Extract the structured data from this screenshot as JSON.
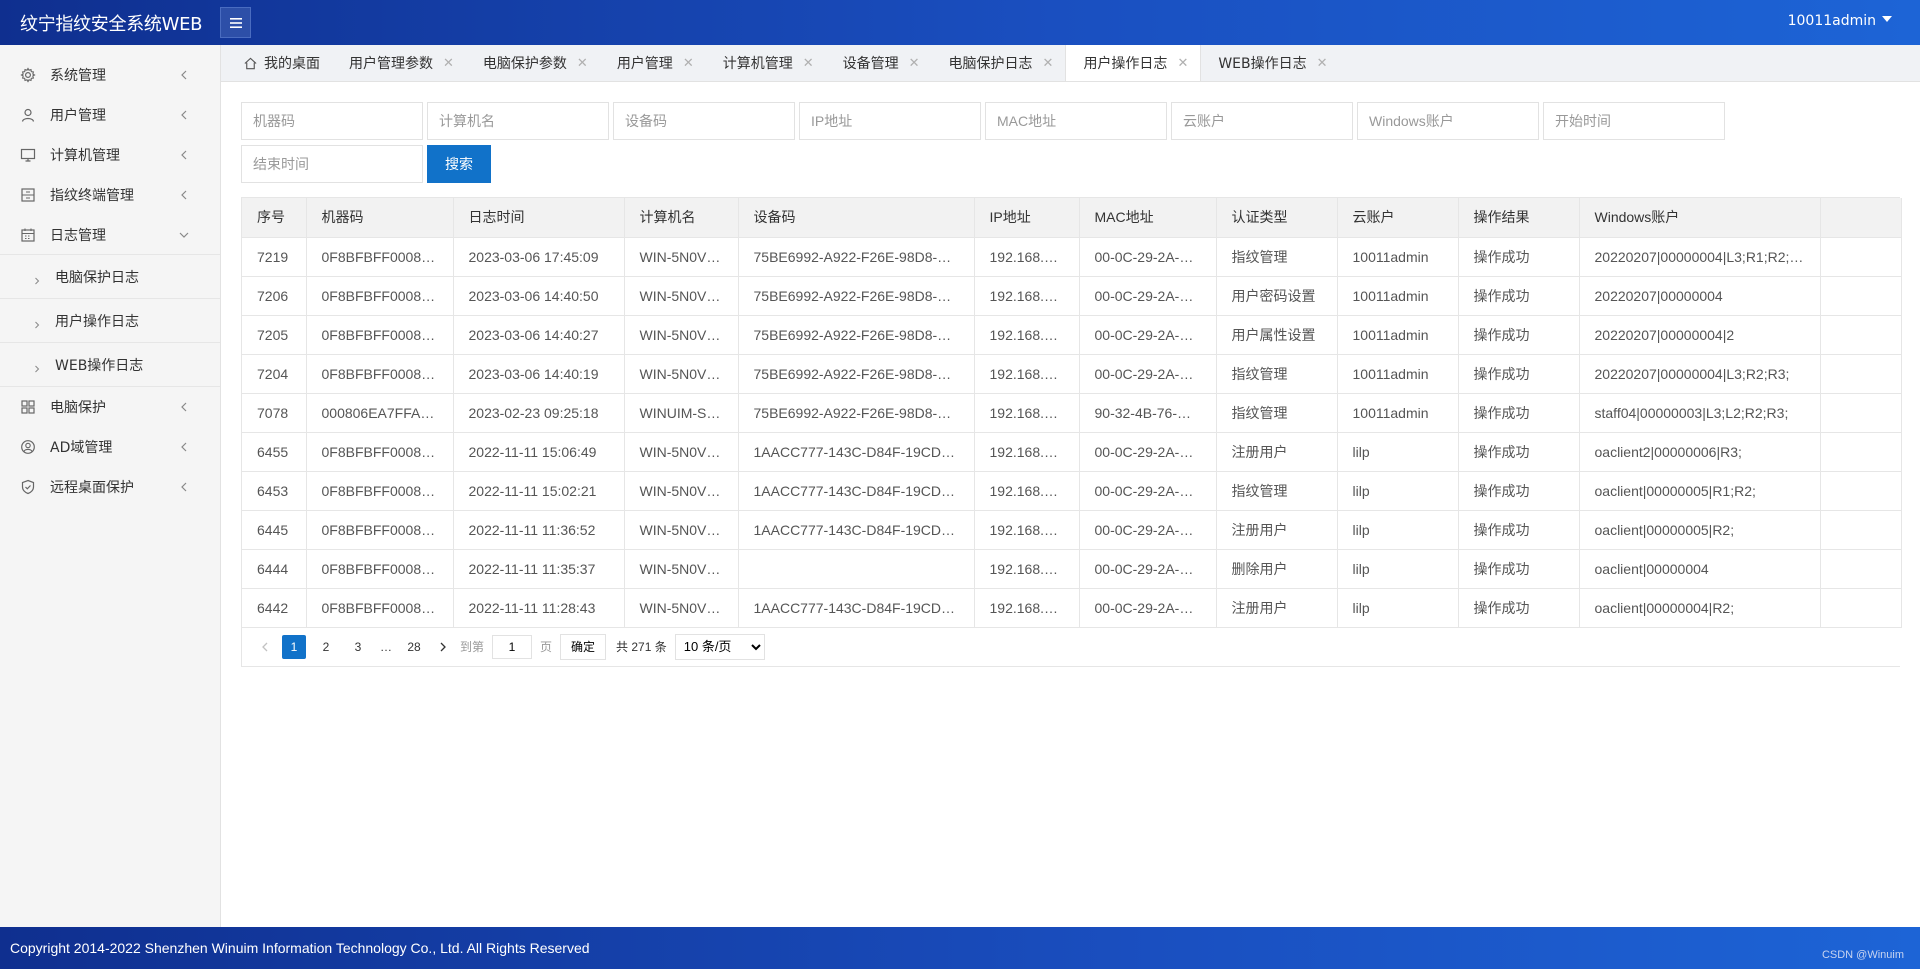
{
  "app": {
    "title": "纹宁指纹安全系统WEB",
    "user": "10011admin"
  },
  "sidebar": {
    "items": [
      {
        "label": "系统管理",
        "icon": "gear-icon"
      },
      {
        "label": "用户管理",
        "icon": "user-icon"
      },
      {
        "label": "计算机管理",
        "icon": "monitor-icon"
      },
      {
        "label": "指纹终端管理",
        "icon": "terminal-icon"
      },
      {
        "label": "日志管理",
        "icon": "calendar-icon"
      }
    ],
    "log_sub": [
      "电脑保护日志",
      "用户操作日志",
      "WEB操作日志"
    ],
    "items_after": [
      {
        "label": "电脑保护",
        "icon": "grid-icon"
      },
      {
        "label": "AD域管理",
        "icon": "ad-user-icon"
      },
      {
        "label": "远程桌面保护",
        "icon": "shield-icon"
      }
    ]
  },
  "tabs": [
    {
      "label": "我的桌面",
      "closable": false
    },
    {
      "label": "用户管理参数",
      "closable": true
    },
    {
      "label": "电脑保护参数",
      "closable": true
    },
    {
      "label": "用户管理",
      "closable": true
    },
    {
      "label": "计算机管理",
      "closable": true
    },
    {
      "label": "设备管理",
      "closable": true
    },
    {
      "label": "电脑保护日志",
      "closable": true
    },
    {
      "label": "用户操作日志",
      "closable": true,
      "active": true
    },
    {
      "label": "WEB操作日志",
      "closable": true
    }
  ],
  "filters": {
    "machine_code": "机器码",
    "computer_name": "计算机名",
    "device_code": "设备码",
    "ip": "IP地址",
    "mac": "MAC地址",
    "cloud_account": "云账户",
    "windows_account": "Windows账户",
    "start_time": "开始时间",
    "end_time": "结束时间",
    "search_label": "搜索"
  },
  "table": {
    "headers": [
      "序号",
      "机器码",
      "日志时间",
      "计算机名",
      "设备码",
      "IP地址",
      "MAC地址",
      "认证类型",
      "云账户",
      "操作结果",
      "Windows账户"
    ],
    "rows": [
      [
        "7219",
        "0F8BFBFF0008…",
        "2023-03-06 17:45:09",
        "WIN-5N0V…",
        "75BE6992-A922-F26E-98D8-…",
        "192.168.…",
        "00-0C-29-2A-…",
        "指纹管理",
        "10011admin",
        "操作成功",
        "20220207|00000004|L3;R1;R2;…"
      ],
      [
        "7206",
        "0F8BFBFF0008…",
        "2023-03-06 14:40:50",
        "WIN-5N0V…",
        "75BE6992-A922-F26E-98D8-…",
        "192.168.…",
        "00-0C-29-2A-…",
        "用户密码设置",
        "10011admin",
        "操作成功",
        "20220207|00000004"
      ],
      [
        "7205",
        "0F8BFBFF0008…",
        "2023-03-06 14:40:27",
        "WIN-5N0V…",
        "75BE6992-A922-F26E-98D8-…",
        "192.168.…",
        "00-0C-29-2A-…",
        "用户属性设置",
        "10011admin",
        "操作成功",
        "20220207|00000004|2"
      ],
      [
        "7204",
        "0F8BFBFF0008…",
        "2023-03-06 14:40:19",
        "WIN-5N0V…",
        "75BE6992-A922-F26E-98D8-…",
        "192.168.…",
        "00-0C-29-2A-…",
        "指纹管理",
        "10011admin",
        "操作成功",
        "20220207|00000004|L3;R2;R3;"
      ],
      [
        "7078",
        "000806EA7FFA…",
        "2023-02-23 09:25:18",
        "WINUIM-S…",
        "75BE6992-A922-F26E-98D8-…",
        "192.168.…",
        "90-32-4B-76-…",
        "指纹管理",
        "10011admin",
        "操作成功",
        "staff04|00000003|L3;L2;R2;R3;"
      ],
      [
        "6455",
        "0F8BFBFF0008…",
        "2022-11-11 15:06:49",
        "WIN-5N0V…",
        "1AACC777-143C-D84F-19CD…",
        "192.168.…",
        "00-0C-29-2A-…",
        "注册用户",
        "lilp",
        "操作成功",
        "oaclient2|00000006|R3;"
      ],
      [
        "6453",
        "0F8BFBFF0008…",
        "2022-11-11 15:02:21",
        "WIN-5N0V…",
        "1AACC777-143C-D84F-19CD…",
        "192.168.…",
        "00-0C-29-2A-…",
        "指纹管理",
        "lilp",
        "操作成功",
        "oaclient|00000005|R1;R2;"
      ],
      [
        "6445",
        "0F8BFBFF0008…",
        "2022-11-11 11:36:52",
        "WIN-5N0V…",
        "1AACC777-143C-D84F-19CD…",
        "192.168.…",
        "00-0C-29-2A-…",
        "注册用户",
        "lilp",
        "操作成功",
        "oaclient|00000005|R2;"
      ],
      [
        "6444",
        "0F8BFBFF0008…",
        "2022-11-11 11:35:37",
        "WIN-5N0V…",
        "",
        "192.168.…",
        "00-0C-29-2A-…",
        "删除用户",
        "lilp",
        "操作成功",
        "oaclient|00000004"
      ],
      [
        "6442",
        "0F8BFBFF0008…",
        "2022-11-11 11:28:43",
        "WIN-5N0V…",
        "1AACC777-143C-D84F-19CD…",
        "192.168.…",
        "00-0C-29-2A-…",
        "注册用户",
        "lilp",
        "操作成功",
        "oaclient|00000004|R2;"
      ]
    ]
  },
  "pager": {
    "pages": [
      "1",
      "2",
      "3"
    ],
    "ellipsis": "…",
    "last_page": "28",
    "goto_label": "到第",
    "goto_value": "1",
    "page_unit": "页",
    "confirm_label": "确定",
    "total_label": "共 271 条",
    "page_size": "10 条/页"
  },
  "footer": {
    "copyright": "Copyright 2014-2022 Shenzhen Winuim Information Technology Co., Ltd. All Rights Reserved",
    "watermark": "CSDN @Winuim"
  },
  "colors": {
    "header": "#1a4fc0",
    "primary": "#1172c9",
    "footer": "#1a4fc0"
  }
}
